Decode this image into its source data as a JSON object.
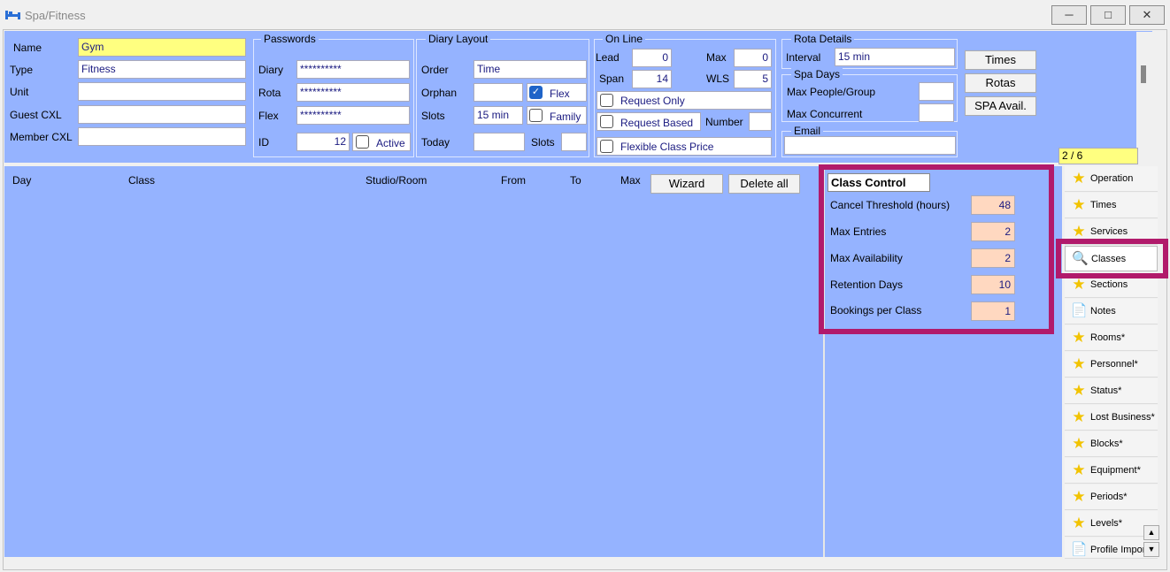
{
  "window": {
    "title": "Spa/Fitness",
    "minimize_glyph": "▭",
    "maximize_glyph": "▢",
    "close_glyph": "✕"
  },
  "record": {
    "name_label": "Name",
    "name_value": "Gym",
    "type_label": "Type",
    "type_value": "Fitness",
    "unit_label": "Unit",
    "unit_value": "",
    "guest_cxl_label": "Guest CXL",
    "guest_cxl_value": "",
    "member_cxl_label": "Member CXL",
    "member_cxl_value": ""
  },
  "passwords": {
    "title": "Passwords",
    "diary_label": "Diary",
    "diary_value": "**********",
    "rota_label": "Rota",
    "rota_value": "**********",
    "flex_label": "Flex",
    "flex_value": "**********",
    "id_label": "ID",
    "id_value": "12",
    "active_label": "Active",
    "active_checked": false
  },
  "diary_layout": {
    "title": "Diary Layout",
    "order_label": "Order",
    "order_value": "Time",
    "orphan_label": "Orphan",
    "orphan_value": "",
    "flex_label": "Flex",
    "flex_checked": true,
    "slots_label": "Slots",
    "slots_value": "15 min",
    "family_label": "Family",
    "family_checked": false,
    "today_label": "Today",
    "today_value": "",
    "slots2_label": "Slots",
    "slots2_value": ""
  },
  "online": {
    "title": "On Line",
    "lead_label": "Lead",
    "lead_value": "0",
    "max_label": "Max",
    "max_value": "0",
    "span_label": "Span",
    "span_value": "14",
    "wls_label": "WLS",
    "wls_value": "5",
    "request_only_label": "Request Only",
    "request_based_label": "Request Based",
    "number_label": "Number",
    "number_value": "",
    "flexible_class_price_label": "Flexible Class Price"
  },
  "rota_details": {
    "title": "Rota Details",
    "interval_label": "Interval",
    "interval_value": "15 min"
  },
  "spa_days": {
    "title": "Spa Days",
    "max_people_label": "Max People/Group",
    "max_people_value": "",
    "max_concurrent_label": "Max Concurrent",
    "max_concurrent_value": ""
  },
  "email": {
    "title": "Email",
    "value": ""
  },
  "side_buttons": {
    "times": "Times",
    "rotas": "Rotas",
    "spa_avail": "SPA Avail."
  },
  "pager": "2 / 6",
  "list_headers": {
    "day": "Day",
    "class": "Class",
    "studio": "Studio/Room",
    "from": "From",
    "to": "To",
    "max": "Max",
    "wizard_button": "Wizard",
    "delete_all_button": "Delete all"
  },
  "class_control": {
    "title": "Class Control",
    "rows": [
      {
        "label": "Cancel Threshold (hours)",
        "value": "48"
      },
      {
        "label": "Max Entries",
        "value": "2"
      },
      {
        "label": "Max Availability",
        "value": "2"
      },
      {
        "label": "Retention Days",
        "value": "10"
      },
      {
        "label": "Bookings per Class",
        "value": "1"
      }
    ]
  },
  "nav": [
    {
      "label": "Operation",
      "icon": "star-icon"
    },
    {
      "label": "Times",
      "icon": "star-icon"
    },
    {
      "label": "Services",
      "icon": "star-icon"
    },
    {
      "label": "Classes",
      "icon": "magnifier-doc-icon"
    },
    {
      "label": "Sections",
      "icon": "star-icon"
    },
    {
      "label": "Notes",
      "icon": "document-icon"
    },
    {
      "label": "Rooms*",
      "icon": "star-icon"
    },
    {
      "label": "Personnel*",
      "icon": "star-icon"
    },
    {
      "label": "Status*",
      "icon": "star-icon"
    },
    {
      "label": "Lost Business*",
      "icon": "star-icon"
    },
    {
      "label": "Blocks*",
      "icon": "star-icon"
    },
    {
      "label": "Equipment*",
      "icon": "star-icon"
    },
    {
      "label": "Periods*",
      "icon": "star-icon"
    },
    {
      "label": "Levels*",
      "icon": "star-icon"
    },
    {
      "label": "Profile Impor",
      "icon": "document-icon"
    }
  ],
  "colors": {
    "panel": "#95b3ff",
    "highlight": "#b11a6b",
    "input_yellow": "#ffff80",
    "input_peach": "#ffd8c0"
  }
}
